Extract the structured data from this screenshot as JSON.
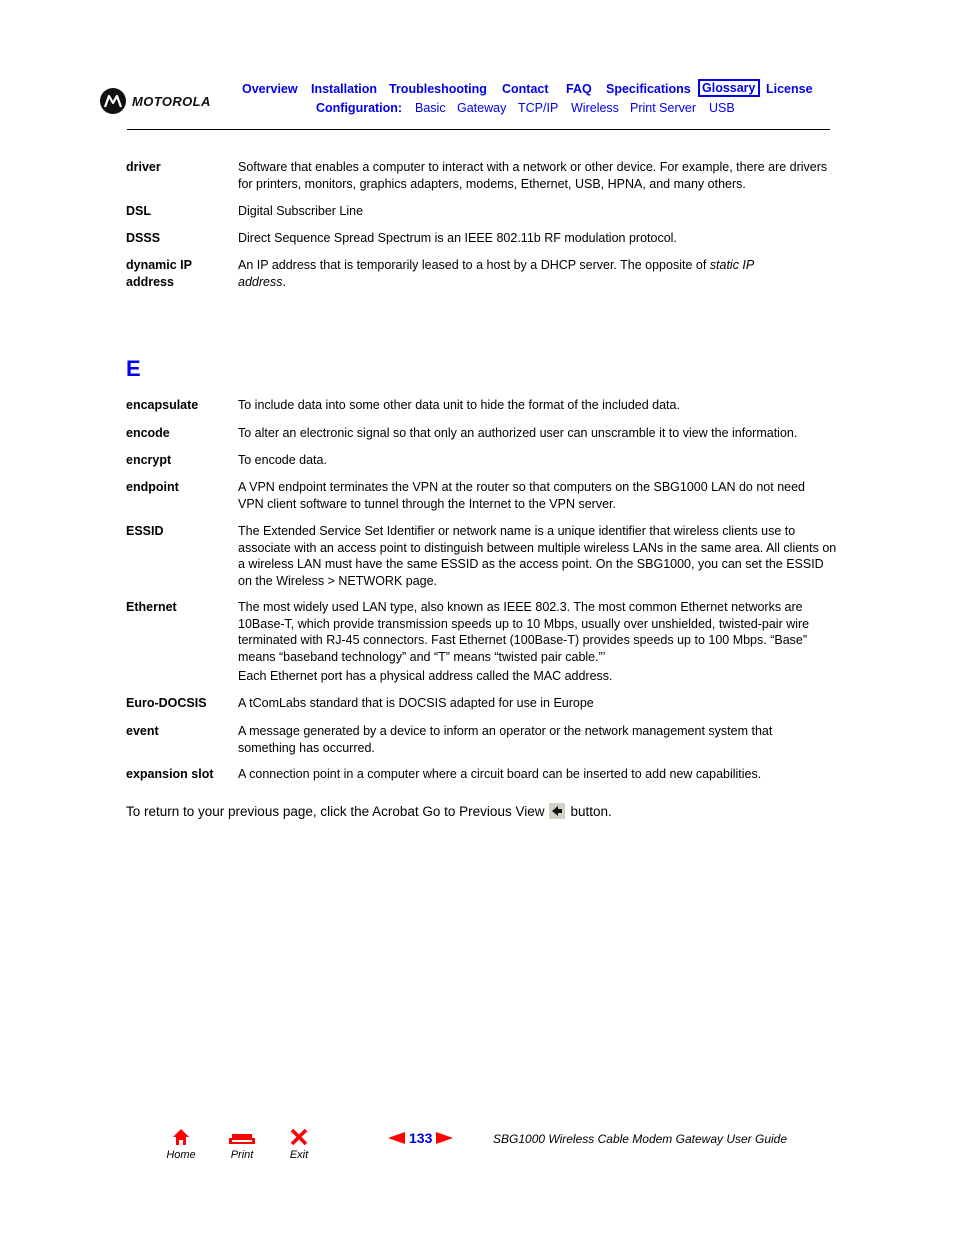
{
  "header": {
    "logo_text": "MOTOROLA",
    "nav_primary": [
      {
        "label": "Overview",
        "active": false
      },
      {
        "label": "Installation",
        "active": false
      },
      {
        "label": "Troubleshooting",
        "active": false
      },
      {
        "label": "Contact",
        "active": false
      },
      {
        "label": "FAQ",
        "active": false
      },
      {
        "label": "Specifications",
        "active": false
      },
      {
        "label": "Glossary",
        "active": true
      },
      {
        "label": "License",
        "active": false
      }
    ],
    "nav_config_label": "Configuration:",
    "nav_config": [
      {
        "label": "Basic"
      },
      {
        "label": "Gateway"
      },
      {
        "label": "TCP/IP"
      },
      {
        "label": "Wireless"
      },
      {
        "label": "Print Server"
      },
      {
        "label": "USB"
      }
    ]
  },
  "colors": {
    "link": "#0000ee",
    "footer_icon": "#ff0000",
    "text": "#000000"
  },
  "glossary_d": [
    {
      "term": "driver",
      "definition": "Software that enables a computer to interact with a network or other device. For example, there are drivers for printers, monitors, graphics adapters, modems, Ethernet, USB, HPNA, and many others."
    },
    {
      "term": "DSL",
      "definition": "Digital Subscriber Line"
    },
    {
      "term": "DSSS",
      "definition": "Direct Sequence Spread Spectrum is an IEEE 802.11b RF modulation protocol."
    },
    {
      "term": "dynamic IP address",
      "definition_prefix": "An IP address that is temporarily leased to a host by a DHCP server. The opposite of ",
      "definition_italic": "static IP address",
      "definition_suffix": "."
    }
  ],
  "section_e": {
    "letter": "E",
    "entries": [
      {
        "term": "encapsulate",
        "definition": "To include data into some other data unit to hide the format of the included data."
      },
      {
        "term": "encode",
        "definition": "To alter an electronic signal so that only an authorized user can unscramble it to view the information."
      },
      {
        "term": "encrypt",
        "definition": "To encode data."
      },
      {
        "term": "endpoint",
        "definition": "A VPN endpoint terminates the VPN at the router so that computers on the SBG1000 LAN do not need VPN client software to tunnel through the Internet to the VPN server."
      },
      {
        "term": "ESSID",
        "definition": "The Extended Service Set Identifier or network name is a unique identifier that wireless clients use to associate with an access point to distinguish between multiple wireless LANs in the same area. All clients on a wireless LAN must have the same ESSID as the access point. On the SBG1000, you can set the ESSID on the Wireless > NETWORK page."
      },
      {
        "term": "Ethernet",
        "definition": "The most widely used LAN type, also known as IEEE 802.3. The most common Ethernet networks are 10Base-T, which provide transmission speeds up to 10 Mbps, usually over unshielded, twisted-pair wire terminated with RJ-45 connectors. Fast Ethernet (100Base-T) provides speeds up to 100 Mbps. “Base” means “baseband technology” and “T” means “twisted pair cable.”’",
        "definition_extra": "Each Ethernet port has a physical address called the MAC address."
      },
      {
        "term": "Euro-DOCSIS",
        "definition": "A tComLabs standard that is DOCSIS adapted for use in Europe"
      },
      {
        "term": "event",
        "definition": "A message generated by a device to inform an operator or the network management system that something has occurred."
      },
      {
        "term": "expansion slot",
        "definition": "A connection point in a computer where a circuit board can be inserted to add new capabilities."
      }
    ]
  },
  "return_note": {
    "before": "To return to your previous page, click the Acrobat Go to Previous View",
    "after": "button.",
    "icon": "back-arrow-icon"
  },
  "footer": {
    "home_label": "Home",
    "print_label": "Print",
    "exit_label": "Exit",
    "page_number": "133",
    "guide_title": "SBG1000 Wireless Cable Modem Gateway User Guide"
  }
}
